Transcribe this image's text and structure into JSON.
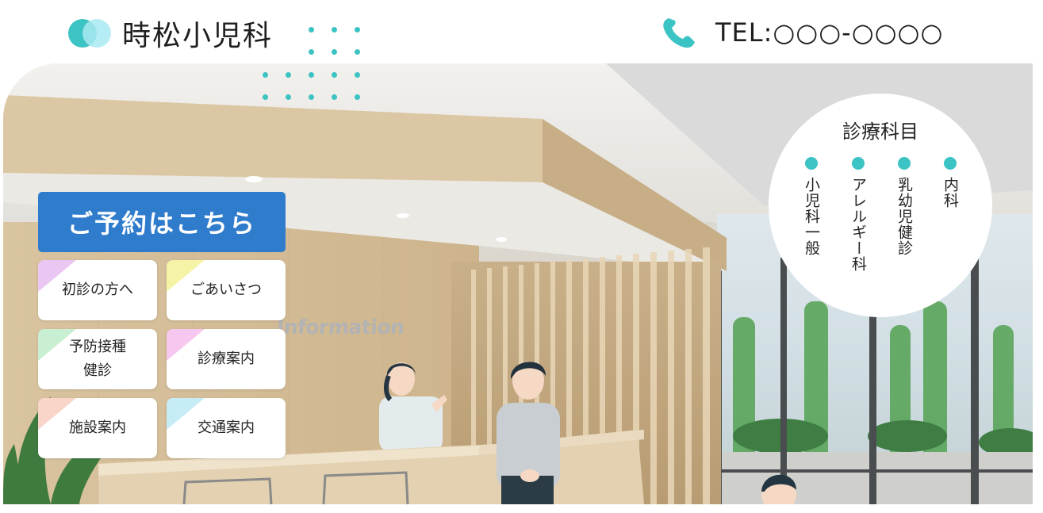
{
  "header": {
    "site_title": "時松小児科",
    "tel": "TEL:○○○-○○○○"
  },
  "hero": {
    "sign_text": "Information",
    "reserve_label": "ご予約はこちら",
    "menu": [
      {
        "label": "初診の方へ",
        "accent": "#eac7f2"
      },
      {
        "label": "ごあいさつ",
        "accent": "#f5f3a6"
      },
      {
        "label": "予防接種\n健診",
        "accent": "#c8efd1"
      },
      {
        "label": "診療案内",
        "accent": "#f6c7ef"
      },
      {
        "label": "施設案内",
        "accent": "#f8d4c9"
      },
      {
        "label": "交通案内",
        "accent": "#c6ecf5"
      }
    ],
    "departments": {
      "title": "診療科目",
      "items": [
        "内科",
        "乳幼児健診",
        "アレルギー科",
        "小児科一般"
      ]
    }
  },
  "colors": {
    "accent": "#3cc3c3",
    "reserve": "#2f7ccc"
  }
}
